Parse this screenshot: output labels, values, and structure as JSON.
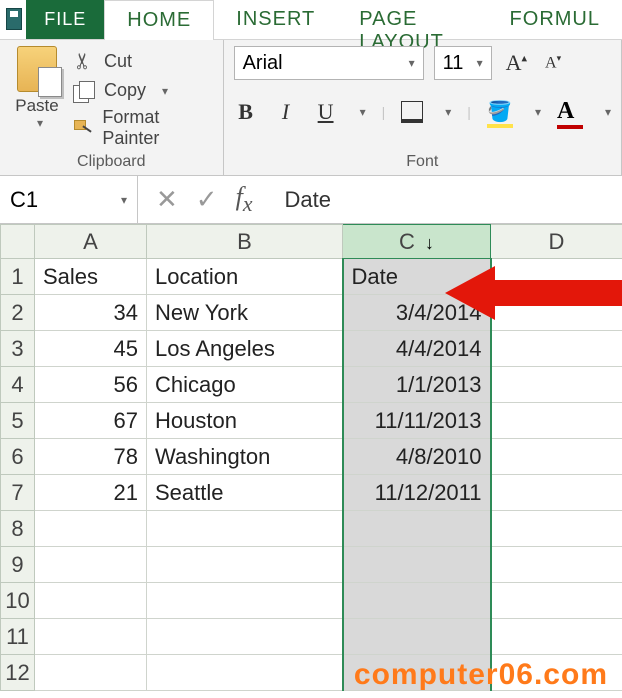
{
  "tabs": {
    "file": "FILE",
    "home": "HOME",
    "insert": "INSERT",
    "page_layout": "PAGE LAYOUT",
    "formulas": "FORMUL"
  },
  "clipboard": {
    "paste": "Paste",
    "cut": "Cut",
    "copy": "Copy",
    "format_painter": "Format Painter",
    "caption": "Clipboard"
  },
  "font": {
    "name": "Arial",
    "size": "11",
    "caption": "Font"
  },
  "formula_bar": {
    "name_box": "C1",
    "value": "Date"
  },
  "grid": {
    "columns": [
      "A",
      "B",
      "C",
      "D"
    ],
    "selected_column": "C",
    "rows": [
      {
        "n": "1",
        "A": "Sales",
        "B": "Location",
        "C": "Date"
      },
      {
        "n": "2",
        "A": "34",
        "B": "New York",
        "C": "3/4/2014"
      },
      {
        "n": "3",
        "A": "45",
        "B": "Los Angeles",
        "C": "4/4/2014"
      },
      {
        "n": "4",
        "A": "56",
        "B": "Chicago",
        "C": "1/1/2013"
      },
      {
        "n": "5",
        "A": "67",
        "B": "Houston",
        "C": "11/11/2013"
      },
      {
        "n": "6",
        "A": "78",
        "B": "Washington",
        "C": "4/8/2010"
      },
      {
        "n": "7",
        "A": "21",
        "B": "Seattle",
        "C": "11/12/2011"
      }
    ]
  },
  "watermark": "computer06.com"
}
